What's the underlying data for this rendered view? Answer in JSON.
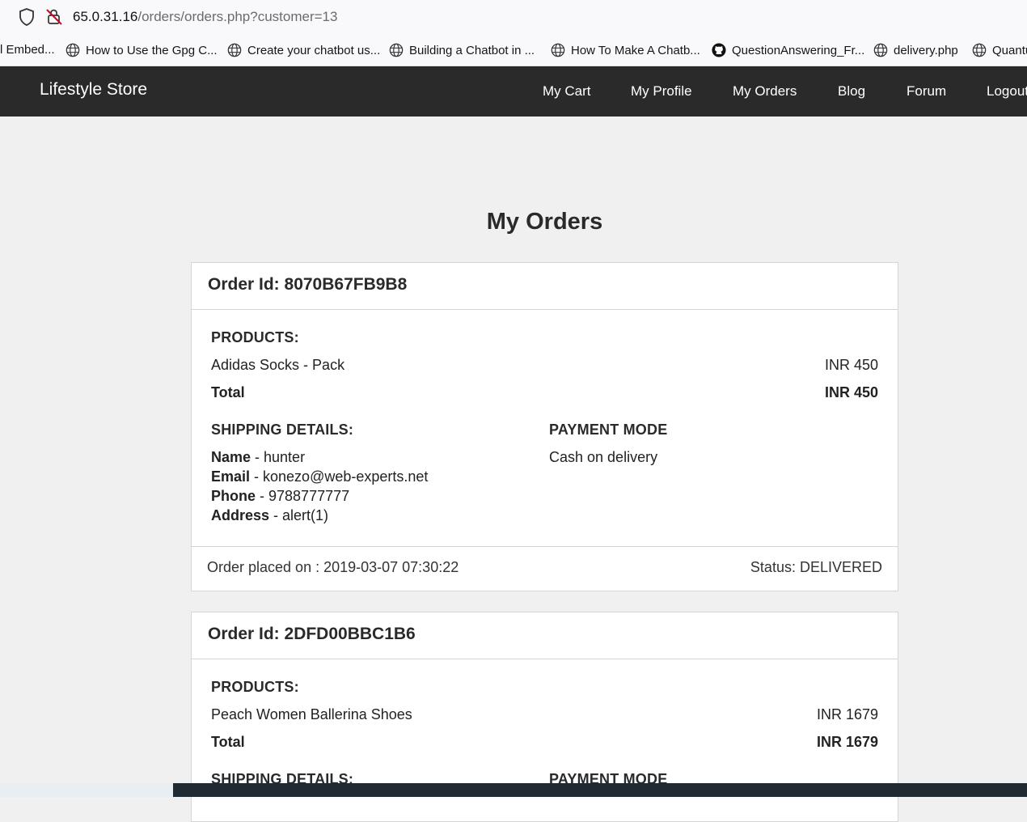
{
  "browser": {
    "url_host": "65.0.31.16",
    "url_path": "/orders/orders.php?customer=13",
    "bookmarks": [
      {
        "label": "l Embed...",
        "icon": "none"
      },
      {
        "label": "How to Use the Gpg C...",
        "icon": "globe-icon"
      },
      {
        "label": "Create your chatbot us...",
        "icon": "globe-icon"
      },
      {
        "label": "Building a Chatbot in ...",
        "icon": "globe-icon"
      },
      {
        "label": "How To Make A Chatb...",
        "icon": "globe-icon"
      },
      {
        "label": "QuestionAnswering_Fr...",
        "icon": "github-icon"
      },
      {
        "label": "delivery.php",
        "icon": "globe-icon"
      },
      {
        "label": "Quantu",
        "icon": "globe-icon"
      }
    ]
  },
  "navbar": {
    "brand": "Lifestyle Store",
    "links": [
      "My Cart",
      "My Profile",
      "My Orders",
      "Blog",
      "Forum",
      "Logout"
    ]
  },
  "page": {
    "title": "My Orders"
  },
  "orders": [
    {
      "order_id_label": "Order Id: 8070B67FB9B8",
      "products_title": "PRODUCTS:",
      "items": [
        {
          "name": "Adidas Socks - Pack",
          "price": "INR 450"
        }
      ],
      "total_label": "Total",
      "total_value": "INR 450",
      "shipping_title": "SHIPPING DETAILS:",
      "shipping": {
        "name_label": "Name",
        "name": " - hunter",
        "email_label": "Email",
        "email": " - konezo@web-experts.net",
        "phone_label": "Phone",
        "phone": " - 9788777777",
        "address_label": "Address",
        "address": " - alert(1)"
      },
      "payment_title": "PAYMENT MODE",
      "payment_mode": "Cash on delivery",
      "placed_on": "Order placed on : 2019-03-07 07:30:22",
      "status": "Status: DELIVERED"
    },
    {
      "order_id_label": "Order Id: 2DFD00BBC1B6",
      "products_title": "PRODUCTS:",
      "items": [
        {
          "name": "Peach Women Ballerina Shoes",
          "price": "INR 1679"
        }
      ],
      "total_label": "Total",
      "total_value": "INR 1679",
      "shipping_title": "SHIPPING DETAILS:",
      "payment_title": "PAYMENT MODE"
    }
  ]
}
